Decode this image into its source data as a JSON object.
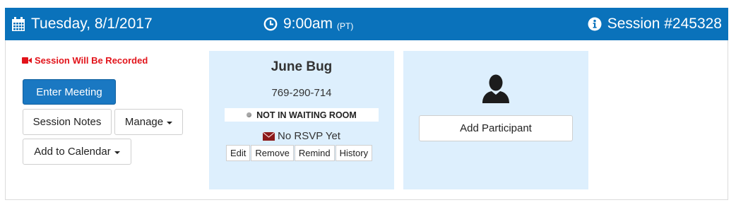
{
  "header": {
    "date": "Tuesday, 8/1/2017",
    "time": "9:00am",
    "timezone": "(PT)",
    "session": "Session #245328",
    "icons": {
      "date": "calendar-icon",
      "time": "clock-icon",
      "session": "info-circle-icon"
    },
    "background_color": "#0a72bb"
  },
  "left": {
    "recording_notice": "Session Will Be Recorded",
    "recording_color": "#e2131a",
    "enter_meeting": "Enter Meeting",
    "session_notes": "Session Notes",
    "manage": "Manage",
    "add_to_calendar": "Add to Calendar"
  },
  "participant": {
    "name": "June Bug",
    "phone": "769-290-714",
    "status": "NOT IN WAITING ROOM",
    "rsvp": "No RSVP Yet",
    "actions": [
      "Edit",
      "Remove",
      "Remind",
      "History"
    ]
  },
  "add_card": {
    "icon": "user-silhouette-icon",
    "label": "Add Participant"
  }
}
